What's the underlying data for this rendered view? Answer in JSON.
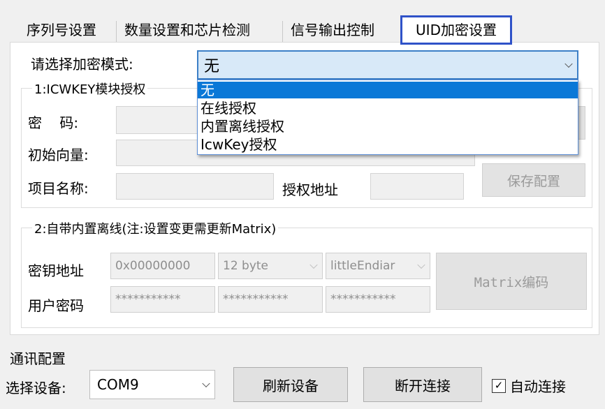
{
  "tabs": [
    {
      "label": "序列号设置"
    },
    {
      "label": "数量设置和芯片检测"
    },
    {
      "label": "信号输出控制"
    },
    {
      "label": "UID加密设置"
    }
  ],
  "encrypt_mode": {
    "label": "请选择加密模式:",
    "selected": "无",
    "options": [
      "无",
      "在线授权",
      "内置离线授权",
      "IcwKey授权"
    ]
  },
  "group1": {
    "legend": "1:ICWKEY模块授权",
    "password_label": "密    码:",
    "iv_label": "初始向量:",
    "project_label": "项目名称:",
    "auth_addr_label": "授权地址",
    "save_button": "保存配置"
  },
  "group2": {
    "legend": "2:自带内置离线(注:设置变更需更新Matrix)",
    "key_addr_label": "密钥地址",
    "key_addr_value": "0x00000000",
    "byte_select": "12 byte",
    "endian_select": "littleEndiar",
    "user_pwd_label": "用户密码",
    "pwd_mask_1": "***********",
    "pwd_mask_2": "***********",
    "pwd_mask_3": "***********",
    "matrix_button": "Matrix编码"
  },
  "comm": {
    "title": "通讯配置",
    "device_label": "选择设备:",
    "device_value": "COM9",
    "refresh_button": "刷新设备",
    "disconnect_button": "断开连接",
    "auto_connect_label": "自动连接",
    "auto_connect_checked": true
  }
}
